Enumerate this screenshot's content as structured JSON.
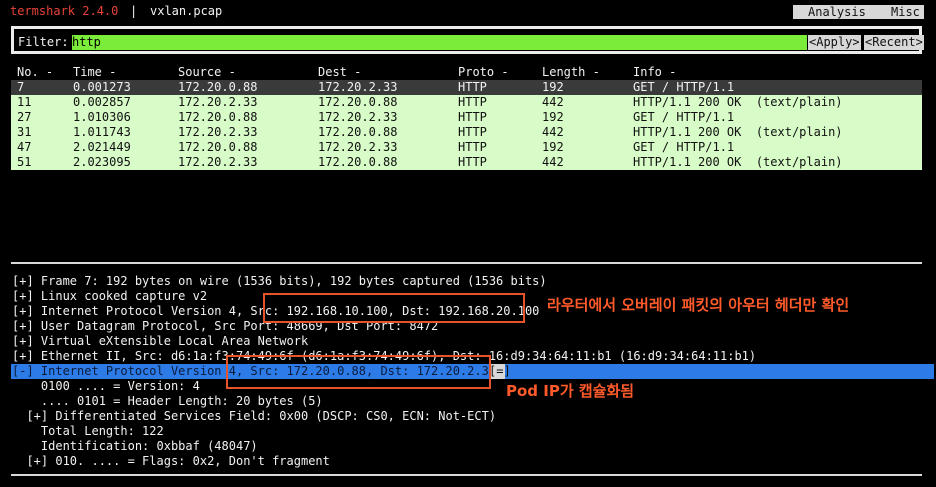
{
  "app": {
    "title": "termshark 2.4.0",
    "divider": "|",
    "file": "vxlan.pcap"
  },
  "menu": {
    "analysis": "Analysis",
    "misc": "Misc"
  },
  "filter": {
    "label": "Filter:",
    "value": "http",
    "apply": "<Apply>",
    "recent": "<Recent>"
  },
  "columns": {
    "no": "No. -",
    "time": "Time -",
    "source": "Source -",
    "dest": "Dest -",
    "proto": "Proto -",
    "length": "Length -",
    "info": "Info -"
  },
  "packets": [
    {
      "no": "7",
      "time": "0.001273",
      "src": "172.20.0.88",
      "dst": "172.20.2.33",
      "proto": "HTTP",
      "len": "192",
      "info": "GET / HTTP/1.1"
    },
    {
      "no": "11",
      "time": "0.002857",
      "src": "172.20.2.33",
      "dst": "172.20.0.88",
      "proto": "HTTP",
      "len": "442",
      "info": "HTTP/1.1 200 OK  (text/plain)"
    },
    {
      "no": "27",
      "time": "1.010306",
      "src": "172.20.0.88",
      "dst": "172.20.2.33",
      "proto": "HTTP",
      "len": "192",
      "info": "GET / HTTP/1.1"
    },
    {
      "no": "31",
      "time": "1.011743",
      "src": "172.20.2.33",
      "dst": "172.20.0.88",
      "proto": "HTTP",
      "len": "442",
      "info": "HTTP/1.1 200 OK  (text/plain)"
    },
    {
      "no": "47",
      "time": "2.021449",
      "src": "172.20.0.88",
      "dst": "172.20.2.33",
      "proto": "HTTP",
      "len": "192",
      "info": "GET / HTTP/1.1"
    },
    {
      "no": "51",
      "time": "2.023095",
      "src": "172.20.2.33",
      "dst": "172.20.0.88",
      "proto": "HTTP",
      "len": "442",
      "info": "HTTP/1.1 200 OK  (text/plain)"
    }
  ],
  "details": [
    "[+] Frame 7: 192 bytes on wire (1536 bits), 192 bytes captured (1536 bits)",
    "[+] Linux cooked capture v2",
    "[+] Internet Protocol Version 4, Src: 192.168.10.100, Dst: 192.168.20.100",
    "[+] User Datagram Protocol, Src Port: 48669, Dst Port: 8472",
    "[+] Virtual eXtensible Local Area Network",
    "[+] Ethernet II, Src: d6:1a:f3:74:49:6f (d6:1a:f3:74:49:6f), Dst: 16:d9:34:64:11:b1 (16:d9:34:64:11:b1)",
    "[-] Internet Protocol Version 4, Src: 172.20.0.88, Dst: 172.20.2.33",
    "    0100 .... = Version: 4",
    "    .... 0101 = Header Length: 20 bytes (5)",
    "  [+] Differentiated Services Field: 0x00 (DSCP: CS0, ECN: Not-ECT)",
    "    Total Length: 122",
    "    Identification: 0xbbaf (48047)",
    "  [+] 010. .... = Flags: 0x2, Don't fragment"
  ],
  "scroll_marker": "[=]",
  "annotations": {
    "outer": "라우터에서 오버레이 패킷의 아우터 헤더만 확인",
    "inner": "Pod IP가 캡슐화됨"
  },
  "colors": {
    "accent_red": "#e8423a",
    "filter_green": "#7cec3a",
    "row_green": "#d8fcc8",
    "selection_blue": "#2d7be6",
    "annotation_orange": "#ff5a2a"
  }
}
